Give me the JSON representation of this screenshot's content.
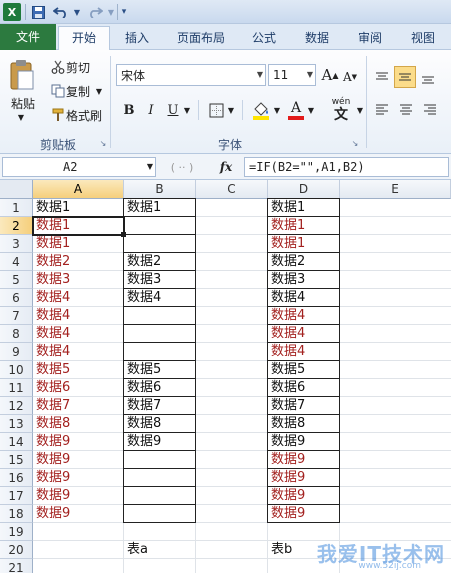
{
  "ribbon": {
    "tabs": [
      "文件",
      "开始",
      "插入",
      "页面布局",
      "公式",
      "数据",
      "审阅",
      "视图"
    ],
    "active_tab": "开始",
    "clipboard": {
      "paste_label": "粘贴",
      "cut_label": "剪切",
      "copy_label": "复制",
      "format_painter_label": "格式刷",
      "group_label": "剪贴板"
    },
    "font": {
      "font_name": "宋体",
      "font_size": "11",
      "bold": "B",
      "italic": "I",
      "underline": "U",
      "grow": "A",
      "shrink": "A",
      "font_color_glyph": "A",
      "phonetic": "wén",
      "group_label": "字体"
    }
  },
  "formula_bar": {
    "name_box": "A2",
    "fx": "fx",
    "formula": "=IF(B2=\"\",A1,B2)"
  },
  "sheet": {
    "columns": [
      "A",
      "B",
      "C",
      "D",
      "E"
    ],
    "rows": [
      "1",
      "2",
      "3",
      "4",
      "5",
      "6",
      "7",
      "8",
      "9",
      "10",
      "11",
      "12",
      "13",
      "14",
      "15",
      "16",
      "17",
      "18",
      "19",
      "20",
      "21"
    ],
    "col_a": [
      "数据1",
      "数据1",
      "数据1",
      "数据2",
      "数据3",
      "数据4",
      "数据4",
      "数据4",
      "数据4",
      "数据5",
      "数据6",
      "数据7",
      "数据8",
      "数据9",
      "数据9",
      "数据9",
      "数据9",
      "数据9"
    ],
    "col_b": [
      "数据1",
      "",
      "",
      "数据2",
      "数据3",
      "数据4",
      "",
      "",
      "",
      "数据5",
      "数据6",
      "数据7",
      "数据8",
      "数据9",
      "",
      "",
      "",
      ""
    ],
    "col_d": [
      "数据1",
      "数据1",
      "数据1",
      "数据2",
      "数据3",
      "数据4",
      "数据4",
      "数据4",
      "数据4",
      "数据5",
      "数据6",
      "数据7",
      "数据8",
      "数据9",
      "数据9",
      "数据9",
      "数据9",
      "数据9"
    ],
    "col_a_red_from_row": 2,
    "col_d_red_rows": [
      2,
      3,
      7,
      8,
      9,
      15,
      16,
      17,
      18
    ],
    "label_b20": "表a",
    "label_d20": "表b",
    "active_cell": "A2"
  },
  "watermark": {
    "text": "我爱IT技术网",
    "url": "www.52ij.com"
  },
  "colors": {
    "red_text": "#a3211f",
    "file_tab": "#2c7a3f",
    "selection_header": "#f5cf7c"
  }
}
